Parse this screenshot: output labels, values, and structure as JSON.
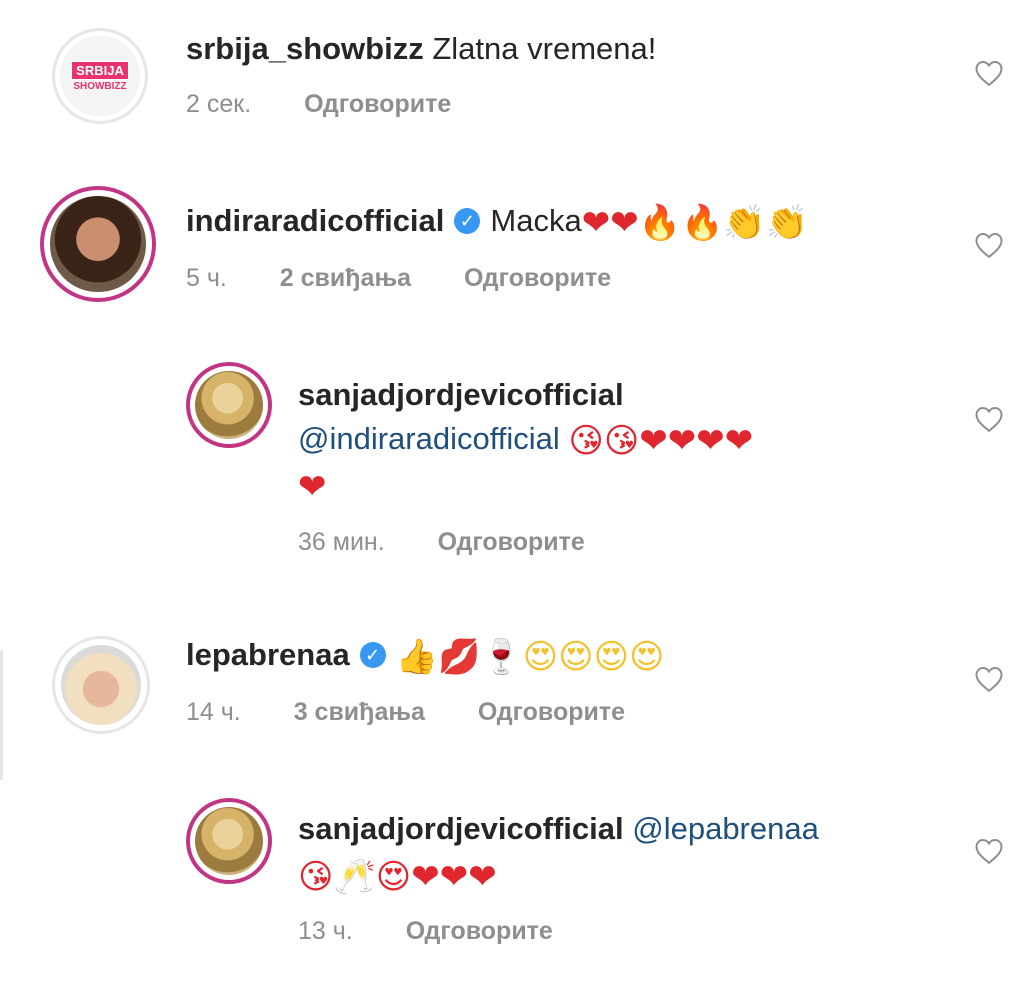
{
  "comments": [
    {
      "username": "srbija_showbizz",
      "text": "Zlatna vremena!",
      "time": "2 сек.",
      "reply_label": "Одговорите",
      "avatar_text_1": "SRBIJA",
      "avatar_text_2": "SHOWBIZZ"
    },
    {
      "username": "indiraradicofficial",
      "text": "Macka",
      "time": "5 ч.",
      "likes": "2 свиђања",
      "reply_label": "Одговорите",
      "emojis": "❤❤🔥🔥👏👏"
    },
    {
      "username": "sanjadjordjevicofficial",
      "mention": "@indiraradicofficial",
      "time": "36 мин.",
      "reply_label": "Одговорите",
      "emojis_line1": "😘😘❤❤❤❤",
      "emojis_line2": "❤"
    },
    {
      "username": "lepabrenaa",
      "time": "14 ч.",
      "likes": "3 свиђања",
      "reply_label": "Одговорите",
      "emojis": "👍💋🍷😍😍😍😍"
    },
    {
      "username": "sanjadjordjevicofficial",
      "mention": "@lepabrenaa",
      "time": "13 ч.",
      "reply_label": "Одговорите",
      "emojis": "😘🥂😍❤❤❤"
    }
  ],
  "icons": {
    "verified": "verified-badge-icon",
    "like": "heart-outline-icon"
  },
  "colors": {
    "avatar_ring": "#c13584",
    "meta_text": "#8e8e8e",
    "mention": "#1f4f7d",
    "verified": "#3897f0",
    "heart": "#e0262e"
  }
}
